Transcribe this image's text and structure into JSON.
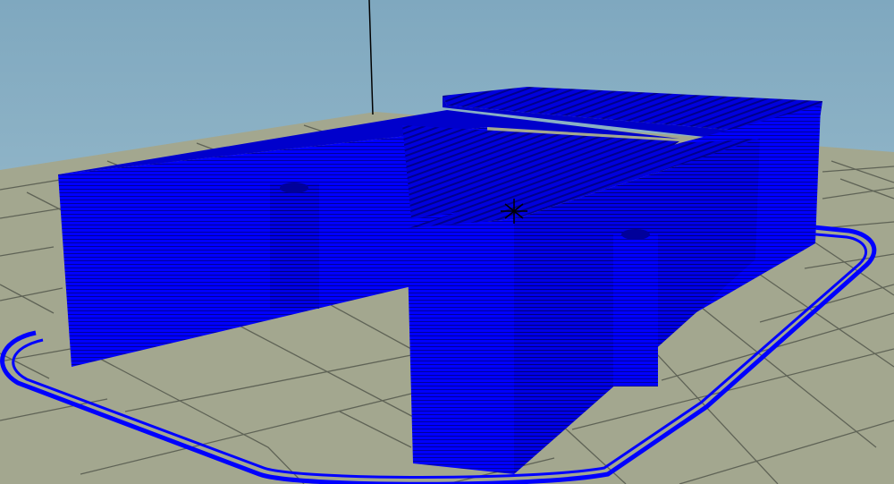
{
  "viewport": {
    "background_top": "#7fa8bf",
    "background_bottom": "#a9c7d4",
    "floor_color": "#a3a78f",
    "grid_line_color": "#5f6356",
    "toolpath_color": "#0000ff",
    "toolpath_dark": "#00009e",
    "origin_marker_color": "#000000"
  }
}
